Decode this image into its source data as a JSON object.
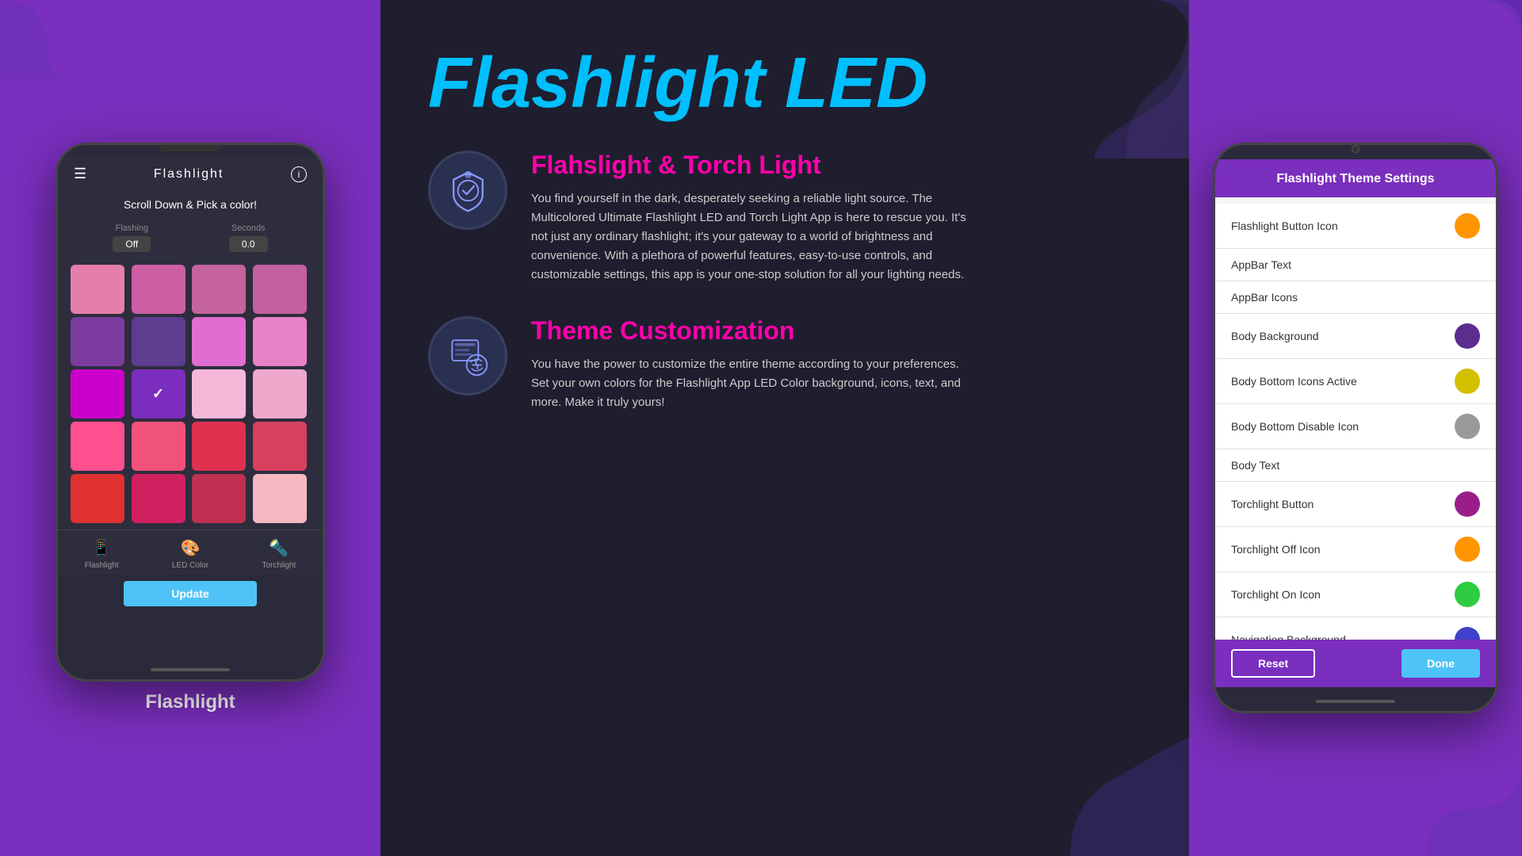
{
  "left_phone": {
    "title": "Flashlight",
    "scroll_text": "Scroll Down & Pick a color!",
    "flashing_label": "Flashing",
    "flashing_value": "Off",
    "seconds_label": "Seconds",
    "seconds_value": "0.0",
    "update_btn": "Update",
    "nav_items": [
      {
        "label": "Flashlight",
        "active": false
      },
      {
        "label": "LED Color",
        "active": true
      },
      {
        "label": "Torchlight",
        "active": false
      }
    ],
    "colors": [
      "#E57EAB",
      "#CC5FA3",
      "#C4639E",
      "#C45FA0",
      "#7B3B9E",
      "#5C3D8F",
      "#E06ED0",
      "#E881C8",
      "#CC00CC",
      "#7B2DBE",
      "#F5B8D8",
      "#EDA8CC",
      "#FF5090",
      "#F0527A",
      "#E03050",
      "#D84060",
      "#E03030",
      "#D02060",
      "#C03050",
      "#F5B8C0"
    ],
    "selected_index": 9,
    "phone_label": "Flashlight"
  },
  "main": {
    "title": "Flashlight LED",
    "feature1": {
      "title": "Flahslight & Torch Light",
      "text": "You find yourself in the dark, desperately seeking a reliable light source. The Multicolored Ultimate Flashlight LED and Torch Light App is here to rescue you. It's not just any ordinary flashlight; it's your gateway to a world of brightness and convenience. With a plethora of powerful features, easy-to-use controls, and customizable settings, this app is your one-stop solution for all your lighting needs."
    },
    "feature2": {
      "title": "Theme Customization",
      "text": "You have the power to customize the entire theme according to your preferences. Set your own colors for the Flashlight App LED Color background, icons, text, and more. Make it truly yours!"
    }
  },
  "settings_phone": {
    "title": "Flashlight Theme Settings",
    "items": [
      {
        "label": "Flashlight Button Icon",
        "color": "#FF9500",
        "has_dot": true
      },
      {
        "label": "AppBar Text",
        "has_dot": false
      },
      {
        "label": "AppBar Icons",
        "has_dot": false
      },
      {
        "label": "Body Background",
        "color": "#5B2D8E",
        "has_dot": true
      },
      {
        "label": "Body Bottom Icons Active",
        "color": "#D4C000",
        "has_dot": true
      },
      {
        "label": "Body Bottom Disable Icon",
        "color": "#999999",
        "has_dot": true
      },
      {
        "label": "Body Text",
        "has_dot": false
      },
      {
        "label": "Torchlight Button",
        "color": "#9B1D8A",
        "has_dot": true
      },
      {
        "label": "Torchlight Off Icon",
        "color": "#FF9500",
        "has_dot": true
      },
      {
        "label": "Torchlight On Icon",
        "color": "#2ECC40",
        "has_dot": true
      },
      {
        "label": "Navigation Background",
        "color": "#4040CC",
        "has_dot": true
      }
    ],
    "reset_btn": "Reset",
    "done_btn": "Done"
  }
}
